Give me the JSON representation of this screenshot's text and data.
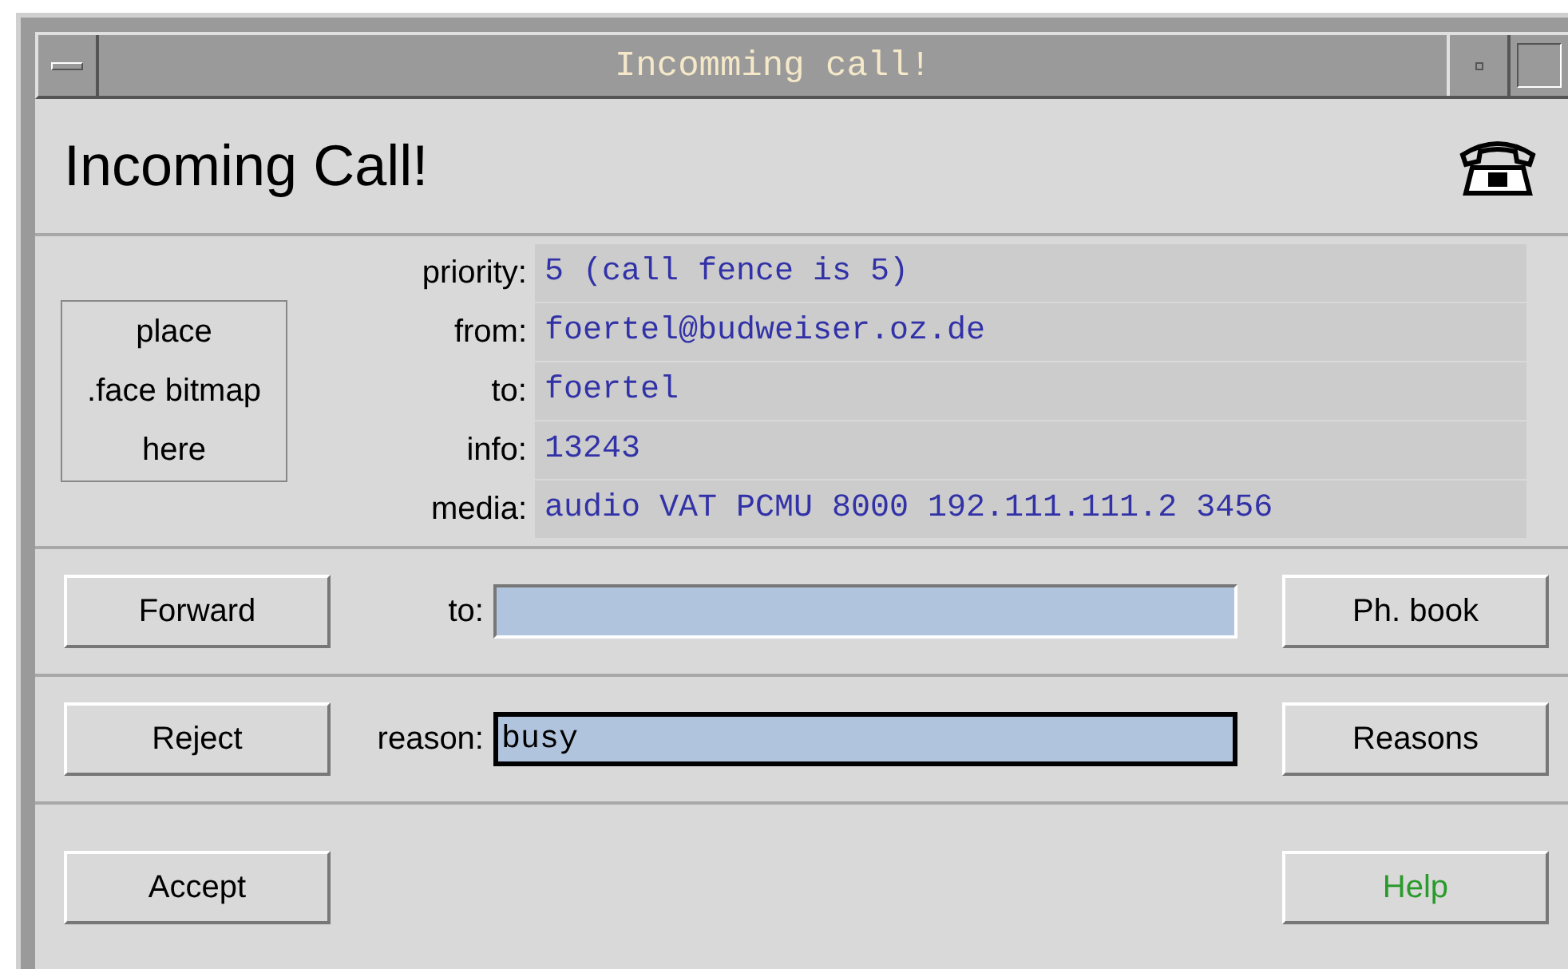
{
  "window": {
    "title": "Incomming call!"
  },
  "heading": "Incoming Call!",
  "face_placeholder": [
    "place",
    ".face bitmap",
    "here"
  ],
  "details": [
    {
      "label": "priority:",
      "value": "5 (call fence is 5)"
    },
    {
      "label": "from:",
      "value": "foertel@budweiser.oz.de"
    },
    {
      "label": "to:",
      "value": "foertel"
    },
    {
      "label": "info:",
      "value": "13243"
    },
    {
      "label": "media:",
      "value": "audio VAT PCMU 8000 192.111.111.2 3456"
    }
  ],
  "actions": [
    {
      "button": "Forward",
      "field_label": "to:",
      "focused": false,
      "side_button": "Ph. book"
    },
    {
      "button": "Reject",
      "field_label": "reason:",
      "field_value": "busy",
      "focused": true,
      "side_button": "Reasons"
    }
  ],
  "bottom_buttons": [
    {
      "label": "Accept",
      "kind": "normal"
    },
    {
      "label": "Help",
      "kind": "help"
    }
  ]
}
